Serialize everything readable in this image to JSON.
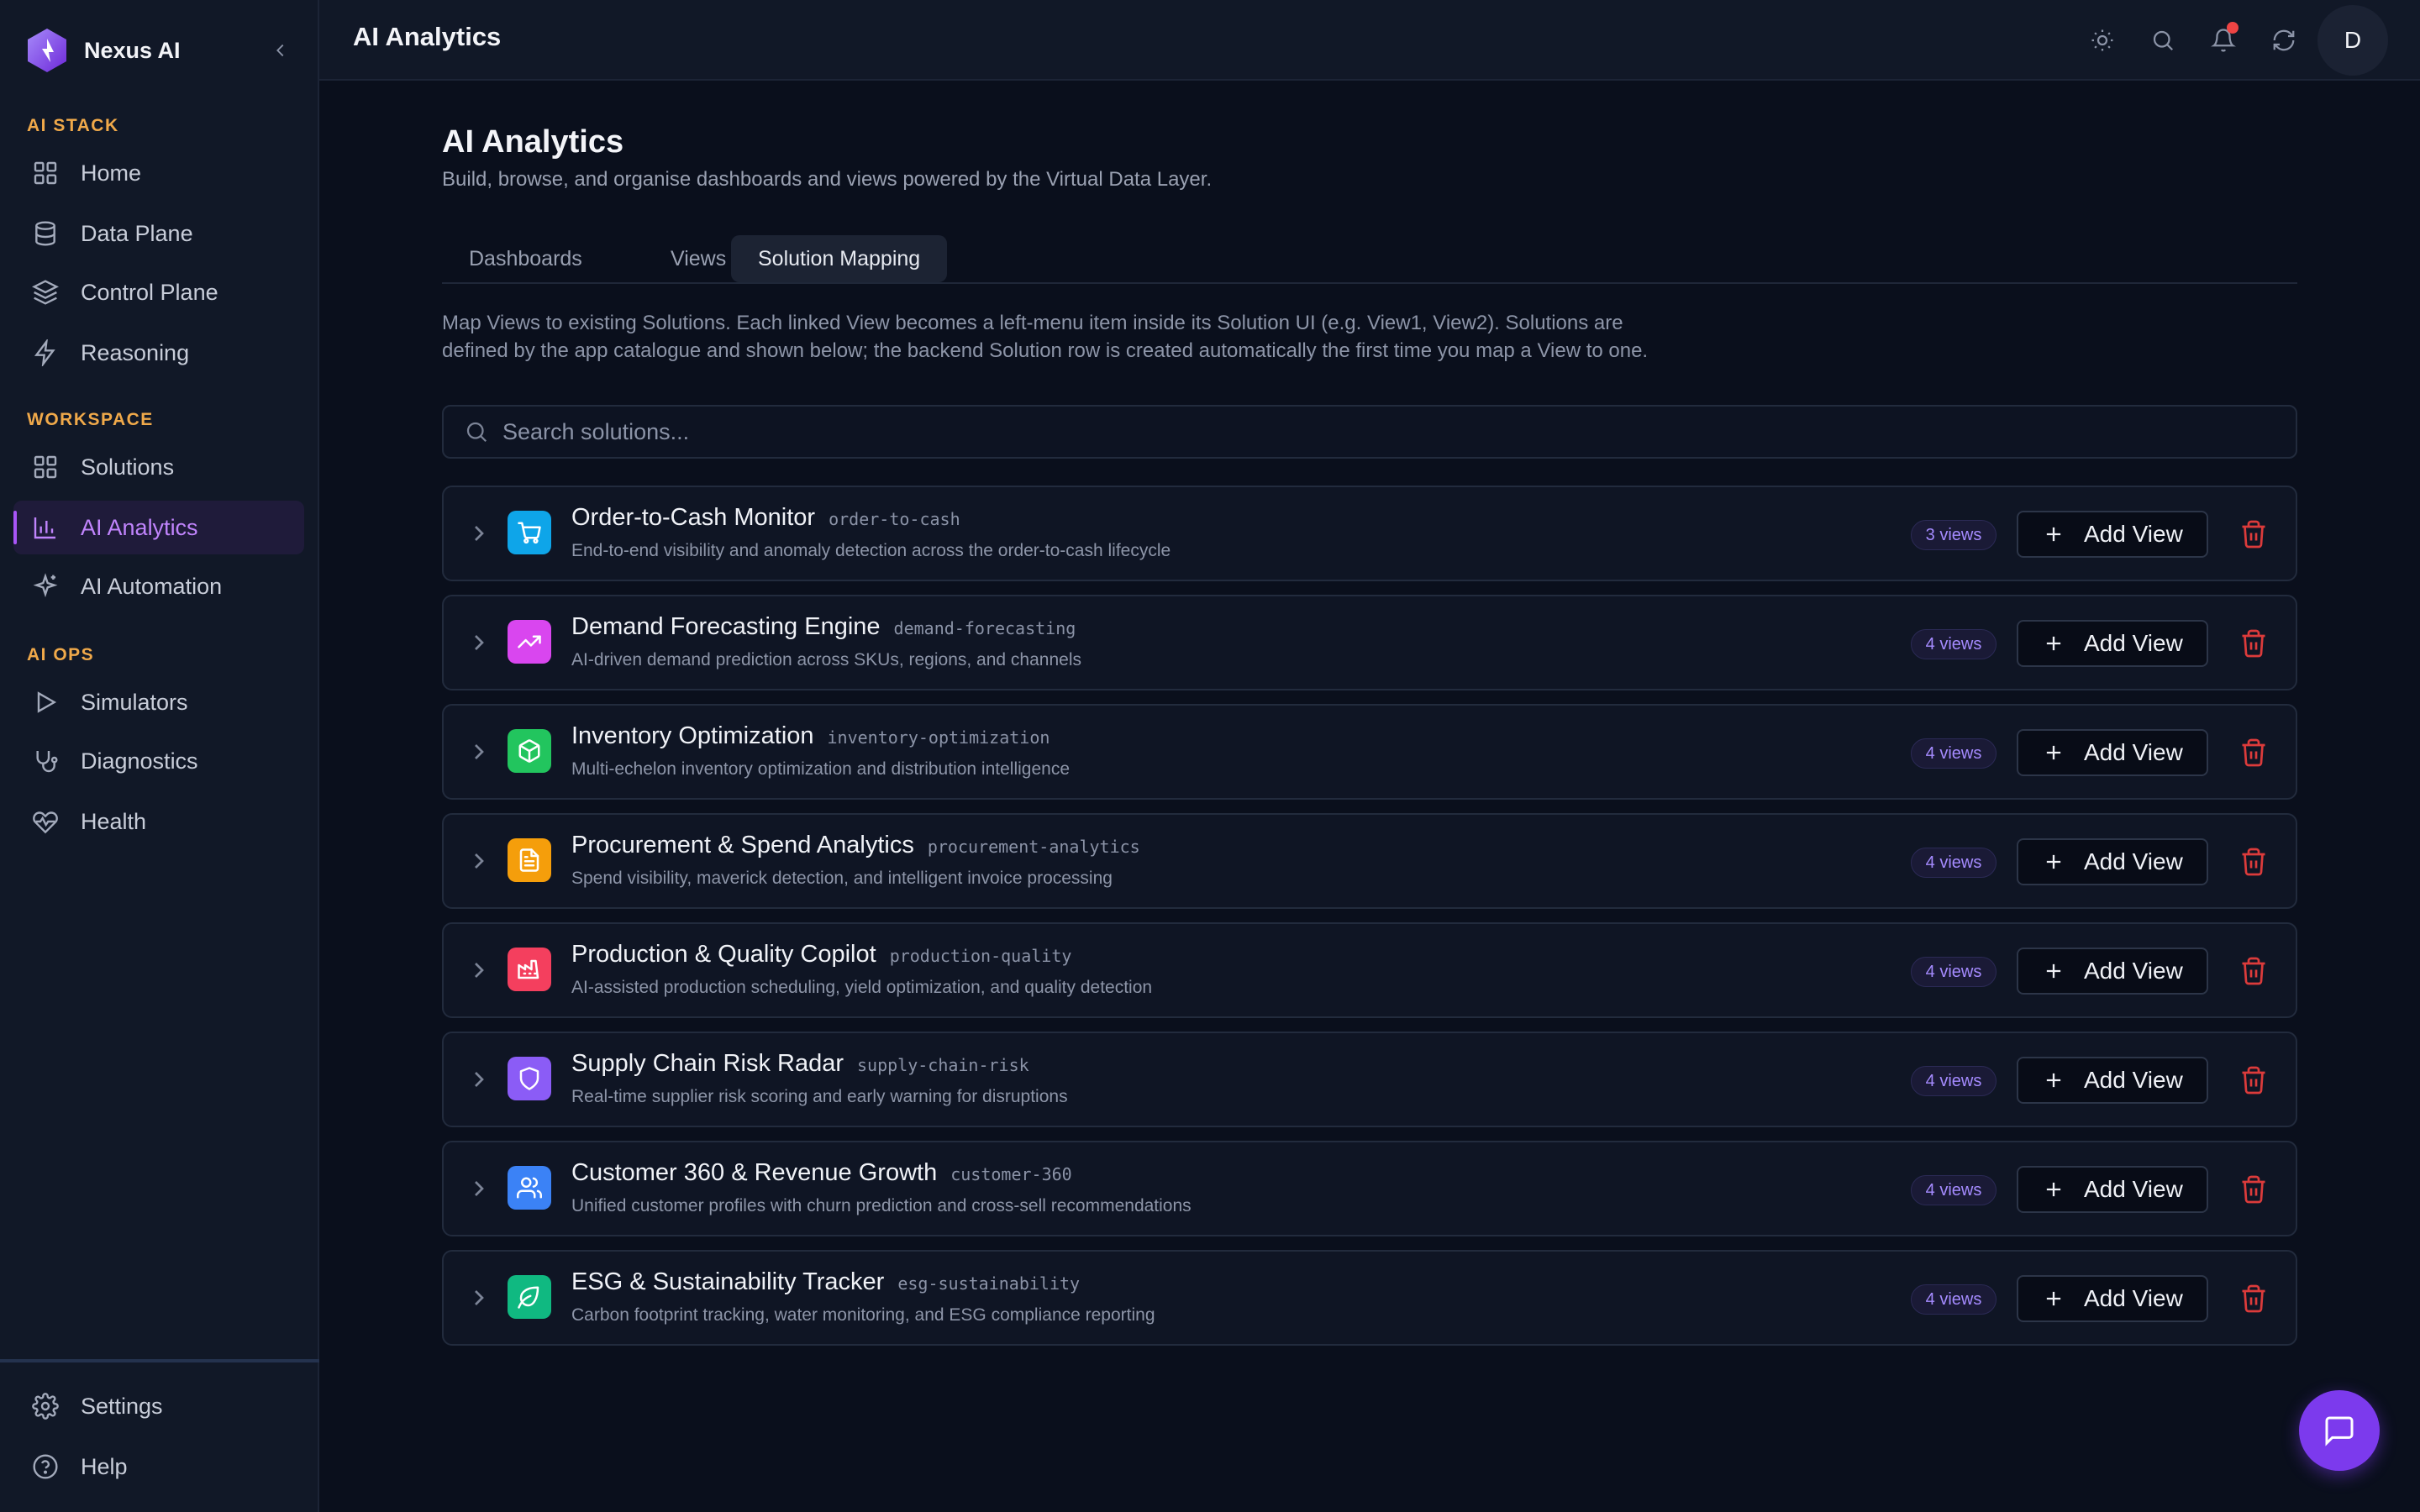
{
  "brand": {
    "name": "Nexus AI"
  },
  "sidebar": {
    "sections": [
      {
        "label": "AI STACK",
        "items": [
          {
            "label": "Home",
            "icon": "grid-icon"
          },
          {
            "label": "Data Plane",
            "icon": "database-icon"
          },
          {
            "label": "Control Plane",
            "icon": "layers-icon"
          },
          {
            "label": "Reasoning",
            "icon": "lightning-icon"
          }
        ]
      },
      {
        "label": "WORKSPACE",
        "items": [
          {
            "label": "Solutions",
            "icon": "grid-icon"
          },
          {
            "label": "AI Analytics",
            "icon": "bar-chart-icon",
            "active": true
          },
          {
            "label": "AI Automation",
            "icon": "sparkles-icon"
          }
        ]
      },
      {
        "label": "AI OPS",
        "items": [
          {
            "label": "Simulators",
            "icon": "play-icon"
          },
          {
            "label": "Diagnostics",
            "icon": "stethoscope-icon"
          },
          {
            "label": "Health",
            "icon": "heart-pulse-icon"
          }
        ]
      }
    ],
    "footer": [
      {
        "label": "Settings",
        "icon": "gear-icon"
      },
      {
        "label": "Help",
        "icon": "help-circle-icon"
      }
    ]
  },
  "header": {
    "title": "AI Analytics",
    "avatar_initial": "D"
  },
  "main": {
    "title": "AI Analytics",
    "subtitle": "Build, browse, and organise dashboards and views powered by the Virtual Data Layer.",
    "tabs": [
      {
        "label": "Dashboards",
        "active": false
      },
      {
        "label": "Views",
        "active": false
      },
      {
        "label": "Solution Mapping",
        "active": true
      }
    ],
    "description_line1": "Map Views to existing Solutions. Each linked View becomes a left-menu item inside its Solution UI (e.g. View1, View2). Solutions are",
    "description_line2": "defined by the app catalogue and shown below; the backend Solution row is created automatically the first time you map a View to one.",
    "search": {
      "placeholder": "Search solutions..."
    },
    "add_view_label": "Add View",
    "solutions": [
      {
        "name": "Order-to-Cash Monitor",
        "slug": "order-to-cash",
        "description": "End-to-end visibility and anomaly detection across the order-to-cash lifecycle",
        "views": "3 views",
        "icon": "shopping-cart-icon",
        "color": "#0ea5e9"
      },
      {
        "name": "Demand Forecasting Engine",
        "slug": "demand-forecasting",
        "description": "AI-driven demand prediction across SKUs, regions, and channels",
        "views": "4 views",
        "icon": "trending-up-icon",
        "color": "#d946ef"
      },
      {
        "name": "Inventory Optimization",
        "slug": "inventory-optimization",
        "description": "Multi-echelon inventory optimization and distribution intelligence",
        "views": "4 views",
        "icon": "package-icon",
        "color": "#22c55e"
      },
      {
        "name": "Procurement & Spend Analytics",
        "slug": "procurement-analytics",
        "description": "Spend visibility, maverick detection, and intelligent invoice processing",
        "views": "4 views",
        "icon": "document-icon",
        "color": "#f59e0b"
      },
      {
        "name": "Production & Quality Copilot",
        "slug": "production-quality",
        "description": "AI-assisted production scheduling, yield optimization, and quality detection",
        "views": "4 views",
        "icon": "factory-icon",
        "color": "#f43f5e"
      },
      {
        "name": "Supply Chain Risk Radar",
        "slug": "supply-chain-risk",
        "description": "Real-time supplier risk scoring and early warning for disruptions",
        "views": "4 views",
        "icon": "shield-icon",
        "color": "#8b5cf6"
      },
      {
        "name": "Customer 360 & Revenue Growth",
        "slug": "customer-360",
        "description": "Unified customer profiles with churn prediction and cross-sell recommendations",
        "views": "4 views",
        "icon": "users-icon",
        "color": "#3b82f6"
      },
      {
        "name": "ESG & Sustainability Tracker",
        "slug": "esg-sustainability",
        "description": "Carbon footprint tracking, water monitoring, and ESG compliance reporting",
        "views": "4 views",
        "icon": "leaf-icon",
        "color": "#10b981"
      }
    ]
  },
  "colors": {
    "accent": "#a855f7",
    "section": "#f0a94a",
    "danger": "#dc3b3b",
    "fab": "#7c3aed"
  }
}
